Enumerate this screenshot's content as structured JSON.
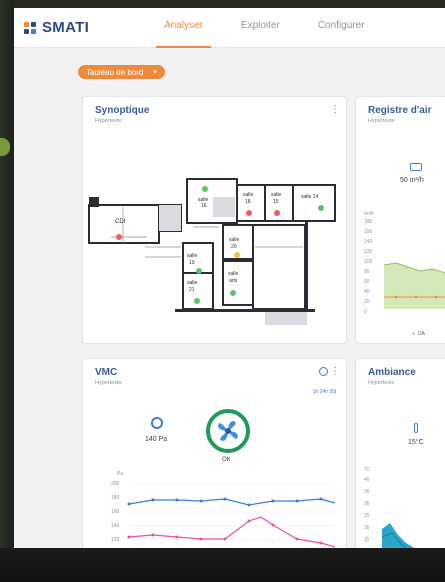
{
  "app": {
    "logo": "SMATI"
  },
  "nav": {
    "tabs": [
      "Analyser",
      "Exploiter",
      "Configurer"
    ],
    "active": 0
  },
  "dashboard": {
    "label": "Tableau de bord"
  },
  "colors": {
    "accent": "#f08a3a",
    "brand": "#2c4a86",
    "fan": "#1f9a5a"
  },
  "synoptique": {
    "title": "Synoptique",
    "subtitle": "Hypertexte",
    "rooms": [
      {
        "label": "CDI",
        "status": "red"
      },
      {
        "label": "salle 16",
        "status": "green"
      },
      {
        "label": "salle 18",
        "status": "red"
      },
      {
        "label": "salle 15",
        "status": "red"
      },
      {
        "label": "salle 14",
        "status": "green"
      },
      {
        "label": "salle 20",
        "status": "yellow"
      },
      {
        "label": "salle 19",
        "status": "green"
      },
      {
        "label": "salle 21",
        "status": "green"
      },
      {
        "label": "salle arts",
        "status": "green"
      }
    ]
  },
  "registre": {
    "title": "Registre d'air",
    "subtitle": "Hypertexte",
    "flow": "50 m³/h",
    "unit": "m³/h",
    "y_ticks": [
      "180",
      "150",
      "140",
      "120",
      "100",
      "80",
      "60",
      "40",
      "20",
      "0"
    ],
    "legend": "DA"
  },
  "vmc": {
    "title": "VMC",
    "subtitle": "Hypertexte",
    "pressure": "140 Pa",
    "fan_status": "OK",
    "unit": "Pa",
    "y_ticks": [
      "200",
      "180",
      "160",
      "140",
      "120"
    ],
    "controls": "1h 24h 30j"
  },
  "ambiance": {
    "title": "Ambiance",
    "subtitle": "Hypertexte",
    "temperature": "15°C",
    "unit": "°C",
    "y_ticks": [
      "40",
      "35",
      "30",
      "25",
      "20",
      "15"
    ]
  }
}
